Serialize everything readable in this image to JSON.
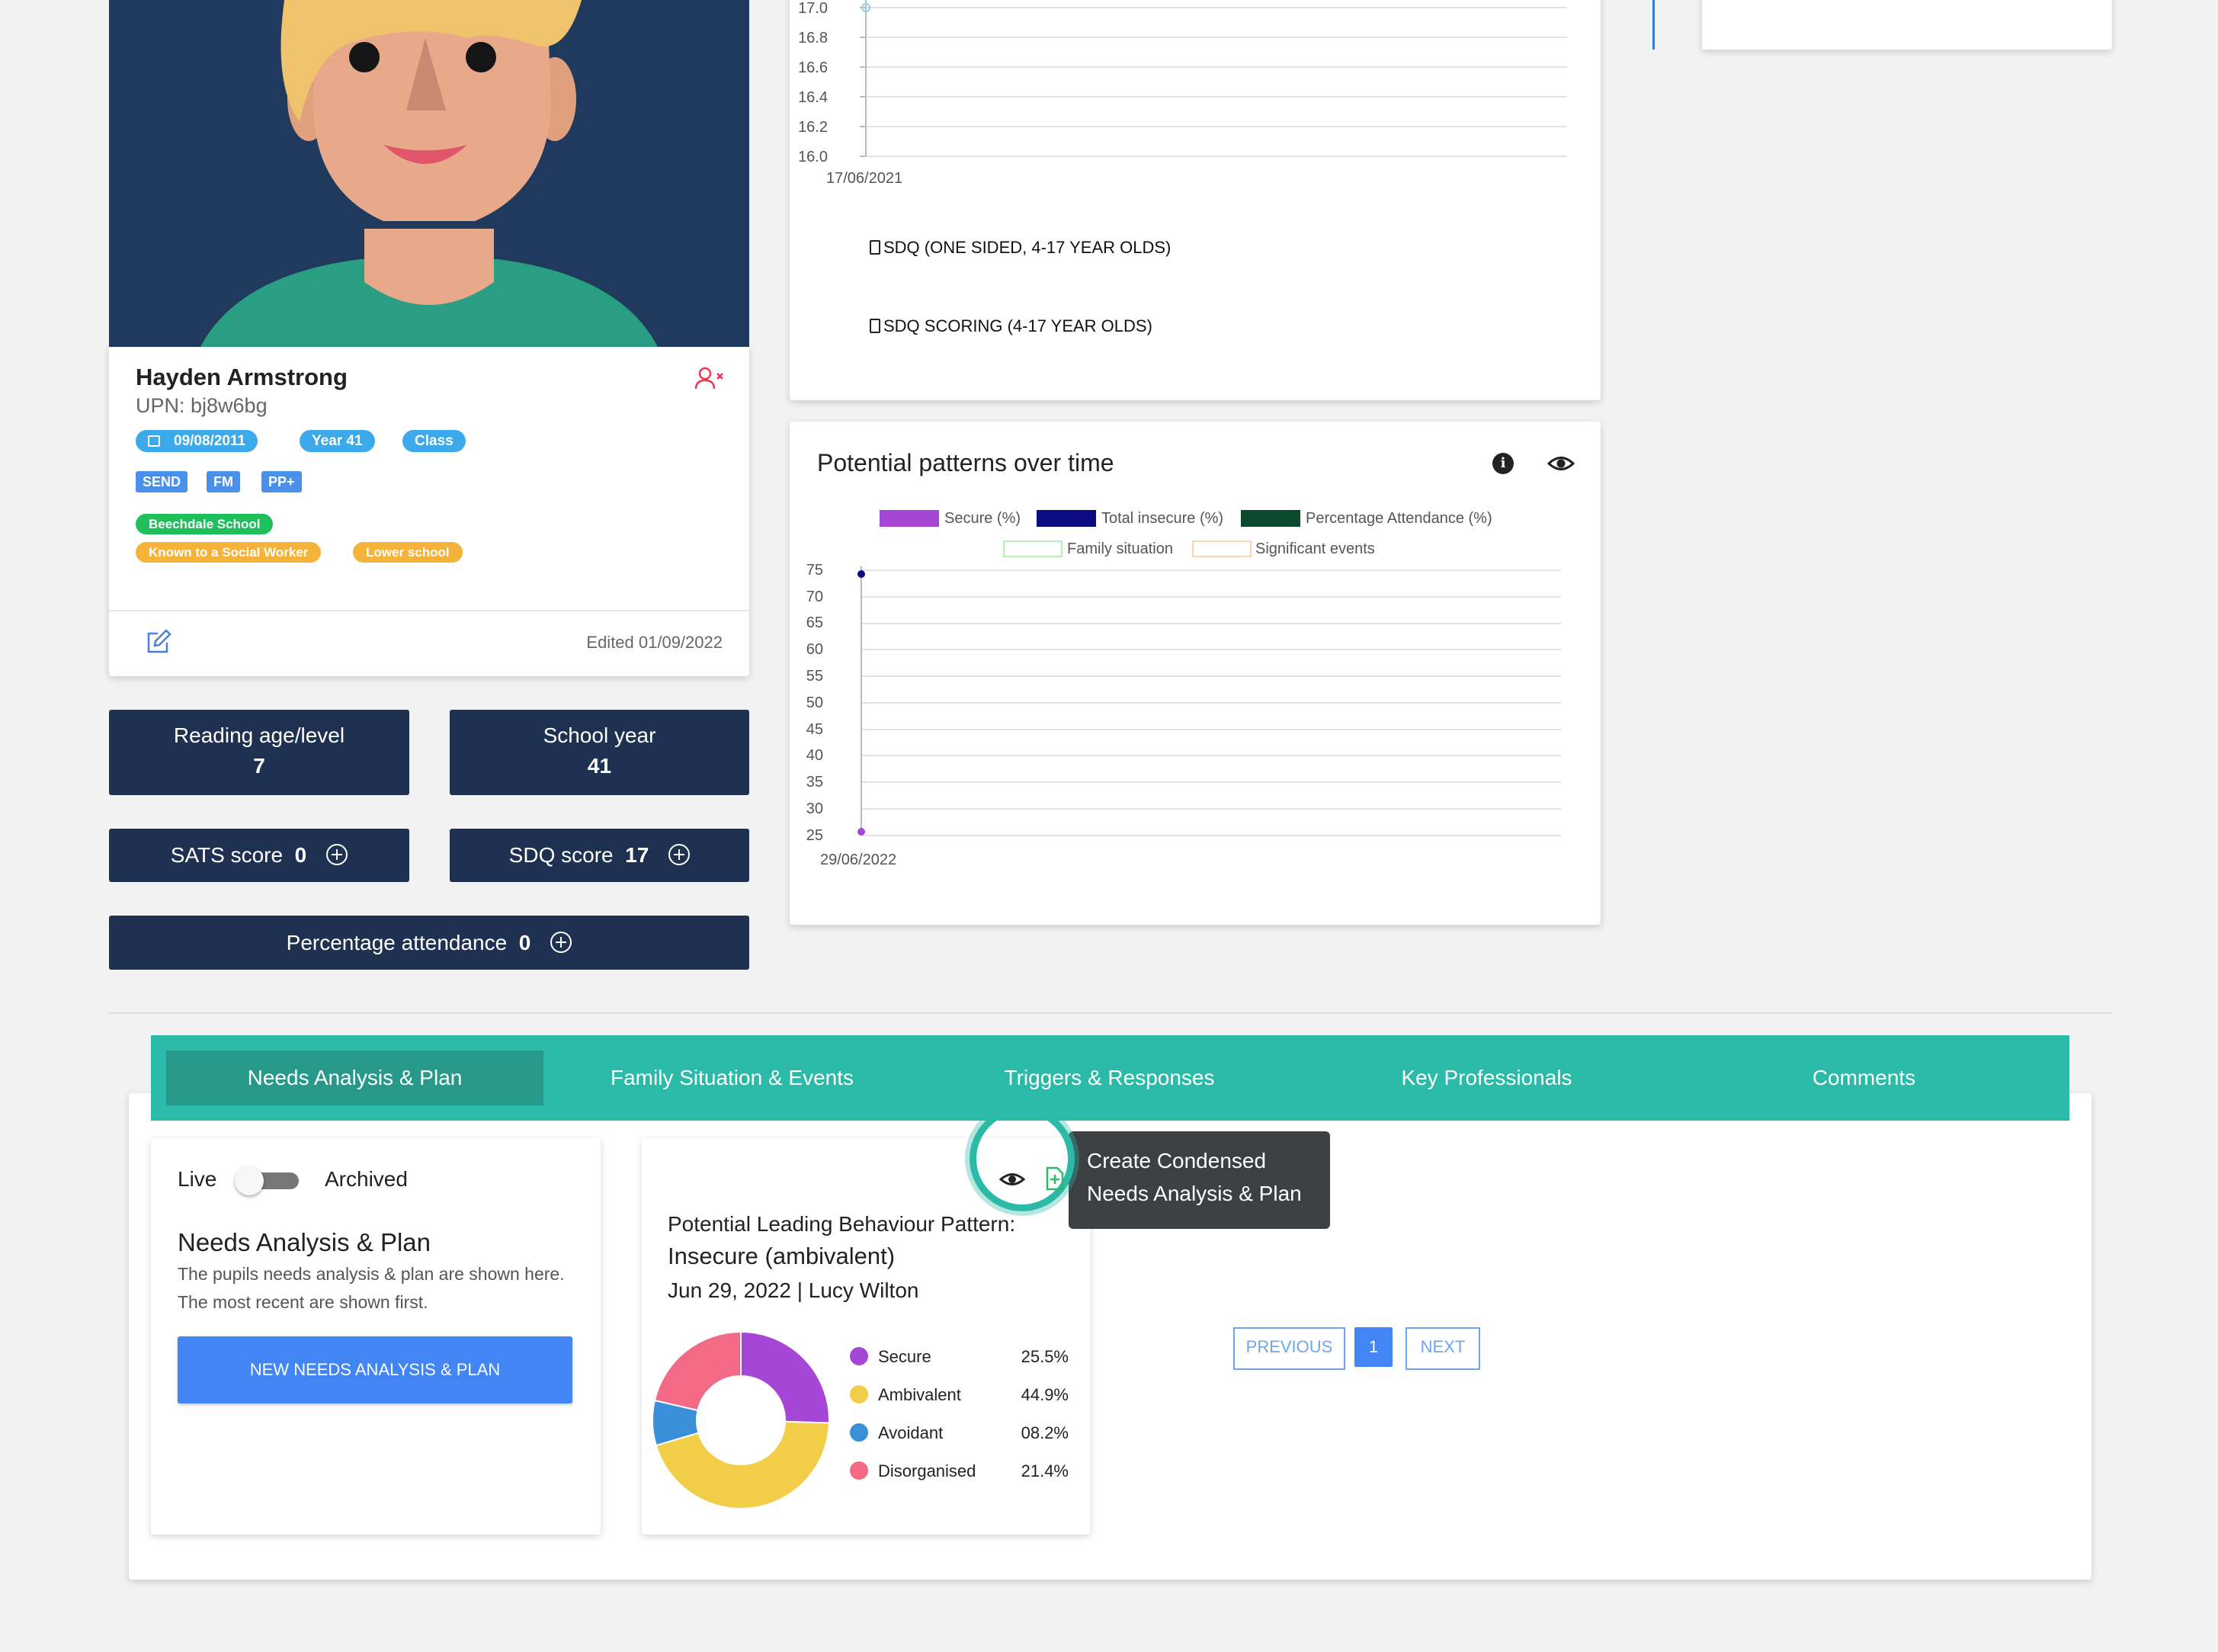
{
  "profile": {
    "name": "Hayden Armstrong",
    "upn": "UPN: bj8w6bg",
    "dob": "09/08/2011",
    "year": "Year 41",
    "class": "Class",
    "flags": [
      "SEND",
      "FM",
      "PP+"
    ],
    "school": "Beechdale School",
    "tags": [
      "Known to a Social Worker",
      "Lower school"
    ],
    "edited": "Edited 01/09/2022"
  },
  "stats": {
    "reading_label": "Reading age/level",
    "reading_value": "7",
    "school_year_label": "School year",
    "school_year_value": "41",
    "sats_label": "SATS score",
    "sats_value": "0",
    "sdq_label": "SDQ score",
    "sdq_value": "17",
    "attendance_label": "Percentage attendance",
    "attendance_value": "0"
  },
  "sdq_chart": {
    "y_ticks": [
      "17.0",
      "16.8",
      "16.6",
      "16.4",
      "16.2",
      "16.0"
    ],
    "x_label": "17/06/2021",
    "links": [
      "SDQ (ONE SIDED, 4-17 YEAR OLDS)",
      "SDQ SCORING (4-17 YEAR OLDS)"
    ]
  },
  "patterns_chart": {
    "title": "Potential patterns over time",
    "legend": [
      "Secure (%)",
      "Total insecure (%)",
      "Percentage Attendance (%)",
      "Family situation",
      "Significant events"
    ],
    "y_ticks": [
      "75",
      "70",
      "65",
      "60",
      "55",
      "50",
      "45",
      "40",
      "35",
      "30",
      "25"
    ],
    "x_label": "29/06/2022"
  },
  "chart_data": [
    {
      "type": "line",
      "x": [
        "17/06/2021"
      ],
      "series": [
        {
          "values": [
            17
          ]
        }
      ],
      "ylim": [
        16.0,
        17.0
      ]
    },
    {
      "type": "line",
      "title": "Potential patterns over time",
      "x": [
        "29/06/2022"
      ],
      "series": [
        {
          "name": "Secure (%)",
          "values": [
            25
          ]
        },
        {
          "name": "Total insecure (%)",
          "values": [
            75
          ]
        },
        {
          "name": "Percentage Attendance (%)",
          "values": []
        },
        {
          "name": "Family situation",
          "values": []
        },
        {
          "name": "Significant events",
          "values": []
        }
      ],
      "ylim": [
        25,
        75
      ]
    },
    {
      "type": "pie",
      "categories": [
        "Secure",
        "Ambivalent",
        "Avoidant",
        "Disorganised"
      ],
      "values": [
        25.5,
        44.9,
        8.2,
        21.4
      ],
      "labels": [
        "25.5%",
        "44.9%",
        "08.2%",
        "21.4%"
      ]
    }
  ],
  "tabs": [
    "Needs Analysis & Plan",
    "Family Situation & Events",
    "Triggers & Responses",
    "Key Professionals",
    "Comments"
  ],
  "needs": {
    "toggle_left": "Live",
    "toggle_right": "Archived",
    "title": "Needs Analysis & Plan",
    "description": "The pupils needs analysis & plan are shown here. The most recent are shown first.",
    "new_button": "NEW NEEDS ANALYSIS & PLAN"
  },
  "plan_card": {
    "heading": "Potential Leading Behaviour Pattern:",
    "pattern": "Insecure (ambivalent)",
    "date_author": "Jun 29, 2022 | Lucy Wilton",
    "tooltip": "Create Condensed Needs Analysis & Plan"
  },
  "pagination": {
    "previous": "PREVIOUS",
    "page": "1",
    "next": "NEXT"
  },
  "colors": {
    "navy": "#1e3150",
    "teal": "#2bbaa7",
    "blue": "#4285f4",
    "secure": "#a646d6",
    "ambivalent": "#f2cd48",
    "avoidant": "#3b8fd8",
    "disorganised": "#f26a85"
  }
}
